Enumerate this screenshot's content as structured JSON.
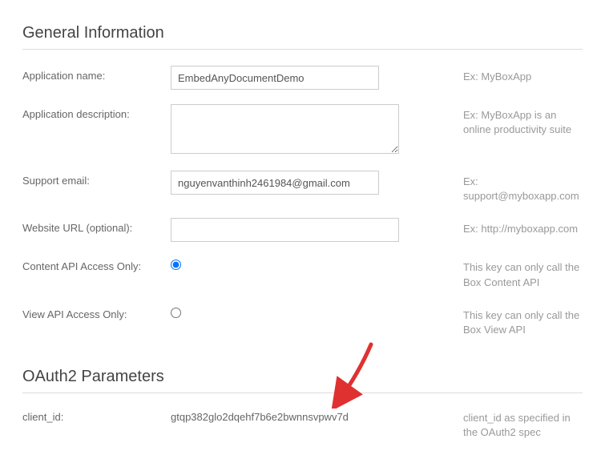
{
  "general": {
    "title": "General Information",
    "appName": {
      "label": "Application name:",
      "value": "EmbedAnyDocumentDemo",
      "help": "Ex: MyBoxApp"
    },
    "appDesc": {
      "label": "Application description:",
      "value": "",
      "help": "Ex: MyBoxApp is an online productivity suite"
    },
    "supportEmail": {
      "label": "Support email:",
      "value": "nguyenvanthinh2461984@gmail.com",
      "help": "Ex: support@myboxapp.com"
    },
    "websiteUrl": {
      "label": "Website URL (optional):",
      "value": "",
      "help": "Ex: http://myboxapp.com"
    },
    "contentApi": {
      "label": "Content API Access Only:",
      "help": "This key can only call the Box Content API"
    },
    "viewApi": {
      "label": "View API Access Only:",
      "help": "This key can only call the Box View API"
    }
  },
  "oauth": {
    "title": "OAuth2 Parameters",
    "clientId": {
      "label": "client_id:",
      "value": "gtqp382glo2dqehf7b6e2bwnnsvpwv7d",
      "help": "client_id as specified in the OAuth2 spec"
    }
  }
}
